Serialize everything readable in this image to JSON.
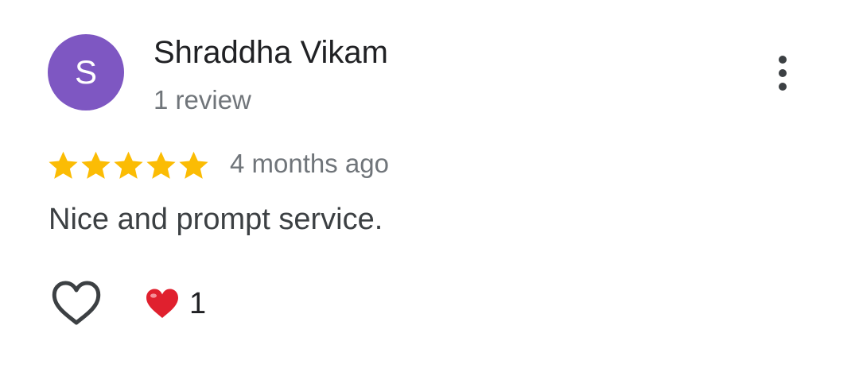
{
  "review": {
    "reviewer": {
      "initial": "S",
      "name": "Shraddha Vikam",
      "review_count": "1 review",
      "avatar_color": "#7e57c2"
    },
    "rating": 5,
    "rating_max": 5,
    "star_color": "#fbbc04",
    "date": "4 months ago",
    "text": "Nice and prompt service.",
    "reactions": {
      "icon": "red-heart-emoji",
      "count": "1"
    },
    "actions": {
      "like_icon": "heart-outline-icon",
      "more_icon": "more-vertical-icon"
    }
  }
}
